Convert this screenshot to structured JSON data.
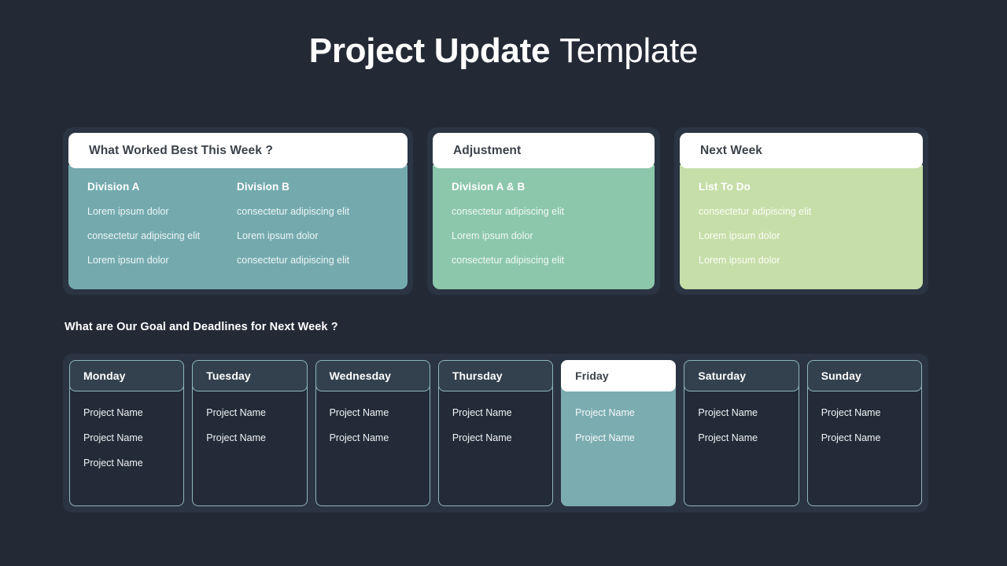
{
  "title": {
    "bold": "Project Update",
    "light": "Template"
  },
  "colors": {
    "page_background": "#232a36",
    "frame": "#2b3442",
    "teal": "#74aaae",
    "green": "#8cc7ab",
    "lime": "#c6dea8",
    "header_white": "#ffffff",
    "header_text": "#3c424b",
    "day_head": "#33414f",
    "day_body": "#232b38",
    "day_border": "#8fb6bb",
    "active_day_body": "#7aacb0"
  },
  "cards": [
    {
      "header": "What Worked Best This Week ?",
      "accent": "teal",
      "columns": [
        {
          "heading": "Division A",
          "items": [
            "Lorem ipsum dolor",
            "consectetur adipiscing elit",
            "Lorem ipsum dolor"
          ]
        },
        {
          "heading": "Division B",
          "items": [
            "consectetur adipiscing elit",
            "Lorem ipsum dolor",
            "consectetur adipiscing elit"
          ]
        }
      ]
    },
    {
      "header": "Adjustment",
      "accent": "green",
      "columns": [
        {
          "heading": "Division A & B",
          "items": [
            "consectetur adipiscing elit",
            "Lorem ipsum dolor",
            "consectetur adipiscing elit"
          ]
        }
      ]
    },
    {
      "header": "Next Week",
      "accent": "lime",
      "columns": [
        {
          "heading": "List To Do",
          "items": [
            "consectetur adipiscing elit",
            "Lorem ipsum dolor",
            "Lorem ipsum dolor"
          ]
        }
      ]
    }
  ],
  "subheading": "What are Our Goal and Deadlines for Next Week ?",
  "week": [
    {
      "day": "Monday",
      "active": false,
      "items": [
        "Project Name",
        "Project Name",
        "Project Name"
      ]
    },
    {
      "day": "Tuesday",
      "active": false,
      "items": [
        "Project Name",
        "Project Name"
      ]
    },
    {
      "day": "Wednesday",
      "active": false,
      "items": [
        "Project Name",
        "Project Name"
      ]
    },
    {
      "day": "Thursday",
      "active": false,
      "items": [
        "Project Name",
        "Project Name"
      ]
    },
    {
      "day": "Friday",
      "active": true,
      "items": [
        "Project Name",
        "Project Name"
      ]
    },
    {
      "day": "Saturday",
      "active": false,
      "items": [
        "Project Name",
        "Project Name"
      ]
    },
    {
      "day": "Sunday",
      "active": false,
      "items": [
        "Project Name",
        "Project Name"
      ]
    }
  ]
}
